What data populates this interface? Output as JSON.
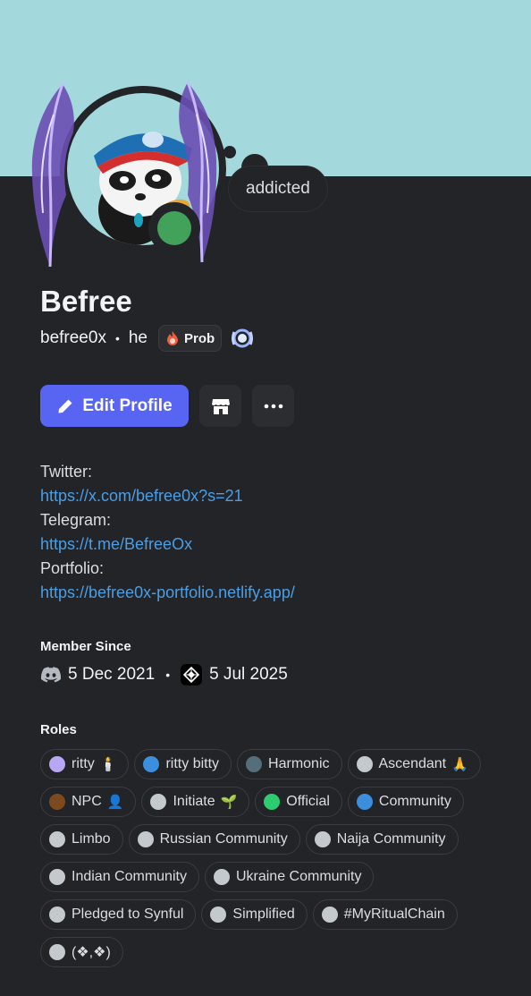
{
  "profile": {
    "display_name": "Befree",
    "username": "befree0x",
    "pronouns": "he",
    "separator": "•",
    "clan_tag": "Prob",
    "custom_status": "addicted",
    "online_color": "#43a25a",
    "banner_color": "#a3d8dc"
  },
  "buttons": {
    "edit_profile": "Edit Profile"
  },
  "bio": {
    "lines": [
      {
        "label": "Twitter:",
        "link": "https://x.com/befree0x?s=21"
      },
      {
        "label": "Telegram:",
        "link": "https://t.me/BefreeOx"
      },
      {
        "label": "Portfolio:",
        "link": "https://befree0x-portfolio.netlify.app/"
      }
    ]
  },
  "member_since": {
    "title": "Member Since",
    "discord_date": "5 Dec 2021",
    "server_date": "5 Jul 2025"
  },
  "roles": {
    "title": "Roles",
    "items": [
      {
        "name": "ritty",
        "color": "#b9a7f5",
        "emoji": "🕯️"
      },
      {
        "name": "ritty bitty",
        "color": "#3b8fdc",
        "emoji": ""
      },
      {
        "name": "Harmonic",
        "color": "#546e7a",
        "emoji": ""
      },
      {
        "name": "Ascendant",
        "color": "#c4c9ce",
        "emoji": "🙏"
      },
      {
        "name": "NPC",
        "color": "#7b4a1e",
        "emoji": "👤"
      },
      {
        "name": "Initiate",
        "color": "#c4c9ce",
        "emoji": "🌱"
      },
      {
        "name": "Official",
        "color": "#2ecc71",
        "emoji": ""
      },
      {
        "name": "Community",
        "color": "#3b8fdc",
        "emoji": ""
      },
      {
        "name": "Limbo",
        "color": "#c4c9ce",
        "emoji": ""
      },
      {
        "name": "Russian Community",
        "color": "#c4c9ce",
        "emoji": ""
      },
      {
        "name": "Naija Community",
        "color": "#c4c9ce",
        "emoji": ""
      },
      {
        "name": "Indian Community",
        "color": "#c4c9ce",
        "emoji": ""
      },
      {
        "name": "Ukraine Community",
        "color": "#c4c9ce",
        "emoji": ""
      },
      {
        "name": "Pledged to Synful",
        "color": "#c4c9ce",
        "emoji": ""
      },
      {
        "name": "Simplified",
        "color": "#c4c9ce",
        "emoji": ""
      },
      {
        "name": "#MyRitualChain",
        "color": "#c4c9ce",
        "emoji": ""
      },
      {
        "name": "(❖,❖)",
        "color": "#c4c9ce",
        "emoji": ""
      }
    ]
  },
  "icons": {
    "edit": "pencil-icon",
    "shop": "shop-icon",
    "more": "more-icon",
    "discord": "discord-icon",
    "guild": "guild-icon",
    "badge": "laurel-badge-icon"
  }
}
